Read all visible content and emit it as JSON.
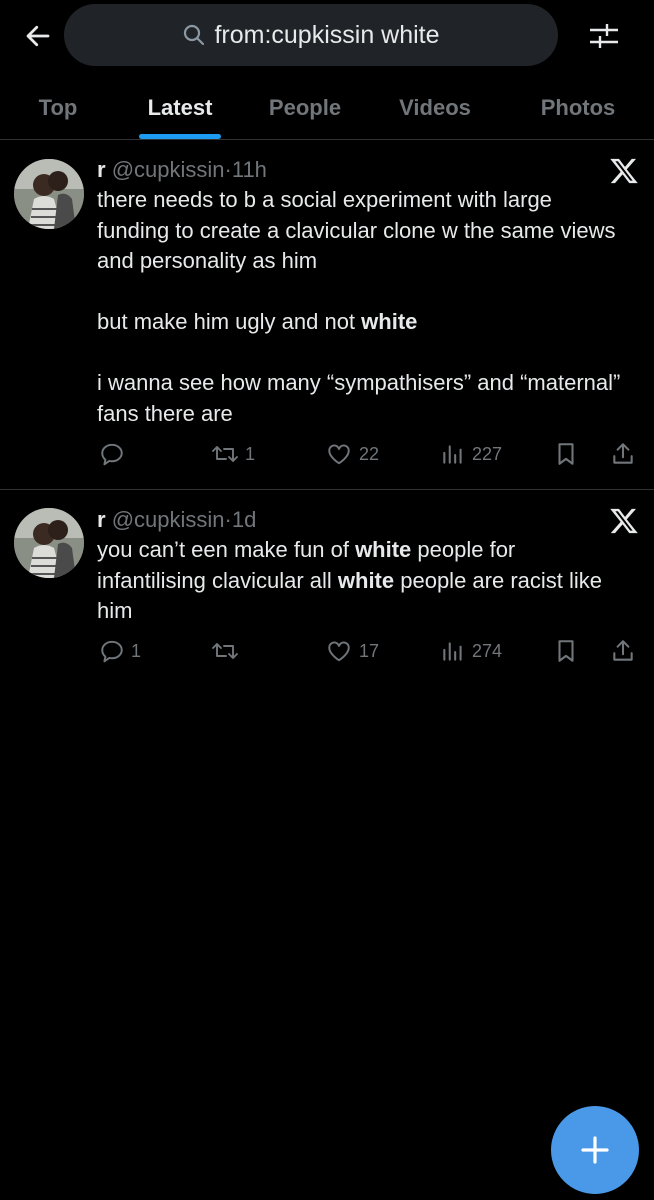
{
  "search": {
    "query": "from:cupkissin white"
  },
  "tabs": [
    {
      "label": "Top",
      "active": false
    },
    {
      "label": "Latest",
      "active": true
    },
    {
      "label": "People",
      "active": false
    },
    {
      "label": "Videos",
      "active": false
    },
    {
      "label": "Photos",
      "active": false
    }
  ],
  "tweets": [
    {
      "name": "r",
      "handle": "@cupkissin",
      "sep": "·",
      "time": "11h",
      "text_parts": [
        "there needs to b a social experiment with large funding to create a clavicular clone w the same views and personality as him\n\nbut make him ugly and not ",
        "white",
        "\n\ni wanna see how many “sympathisers” and “maternal” fans there are"
      ],
      "replies": "",
      "reposts": "1",
      "likes": "22",
      "views": "227"
    },
    {
      "name": "r",
      "handle": "@cupkissin",
      "sep": "·",
      "time": "1d",
      "text_parts": [
        "you can’t een make fun of ",
        "white",
        " people for infantilising clavicular all ",
        "white",
        " people are racist like him"
      ],
      "replies": "1",
      "reposts": "",
      "likes": "17",
      "views": "274"
    }
  ],
  "icons": {
    "back": "arrow-left-icon",
    "search": "search-icon",
    "filter": "sliders-icon",
    "x_logo": "x-logo-icon",
    "reply": "reply-icon",
    "repost": "repost-icon",
    "like": "heart-icon",
    "views": "views-icon",
    "bookmark": "bookmark-icon",
    "share": "share-icon",
    "compose": "plus-icon"
  },
  "colors": {
    "background": "#000000",
    "accent": "#1d9bf0",
    "fab": "#4a99e9",
    "muted": "#71767b",
    "text": "#e7e9ea"
  }
}
